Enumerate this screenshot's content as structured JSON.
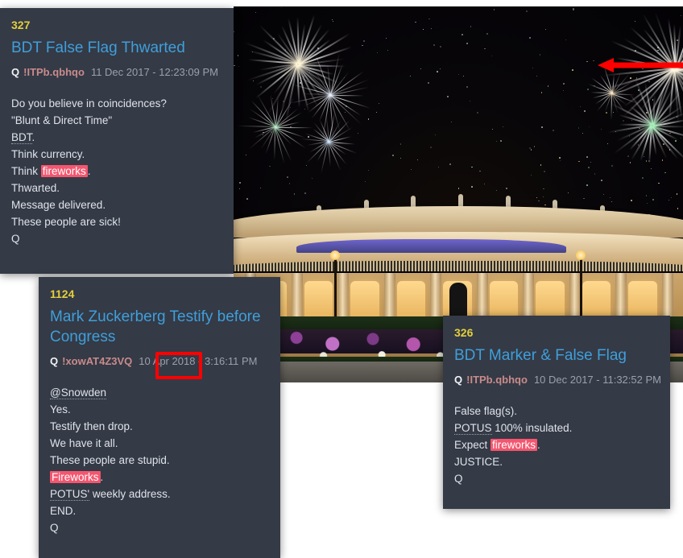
{
  "background_photo": {
    "name": "fireworks-over-resort-building",
    "description": "Night photograph of an illuminated curved neoclassical resort building with rooftop statues, colonnade, fountain and flower beds, with fireworks bursting in the night sky",
    "annotation": {
      "type": "double-headed-arrow",
      "color": "#ff0000"
    }
  },
  "posts": [
    {
      "number": "327",
      "title": "BDT False Flag Thwarted",
      "author": "Q",
      "tripcode": "!ITPb.qbhqo",
      "date": "11 Dec 2017 - 12:23:09 PM",
      "lines": [
        [
          {
            "t": "Do you believe in coincidences?"
          }
        ],
        [
          {
            "t": "\"Blunt & Direct Time\""
          }
        ],
        [
          {
            "t": "BDT",
            "style": "dotted"
          },
          {
            "t": "."
          }
        ],
        [
          {
            "t": "Think currency."
          }
        ],
        [
          {
            "t": "Think "
          },
          {
            "t": "fireworks",
            "style": "highlight"
          },
          {
            "t": "."
          }
        ],
        [
          {
            "t": "Thwarted."
          }
        ],
        [
          {
            "t": "Message delivered."
          }
        ],
        [
          {
            "t": "These people are sick!"
          }
        ],
        [
          {
            "t": "Q"
          }
        ]
      ]
    },
    {
      "number": "1124",
      "title": "Mark Zuckerberg Testify before Congress",
      "author": "Q",
      "tripcode": "!xowAT4Z3VQ",
      "date_boxed": "10 Apr",
      "date_rest": "2018 - 3:16:11 PM",
      "lines": [
        [
          {
            "t": "@Snowden",
            "style": "dotted"
          }
        ],
        [
          {
            "t": "Yes."
          }
        ],
        [
          {
            "t": "Testify then drop."
          }
        ],
        [
          {
            "t": "We have it all."
          }
        ],
        [
          {
            "t": "These people are stupid."
          }
        ],
        [
          {
            "t": "Fireworks",
            "style": "highlight"
          },
          {
            "t": "."
          }
        ],
        [
          {
            "t": "POTUS'",
            "style": "dotted"
          },
          {
            "t": " weekly address."
          }
        ],
        [
          {
            "t": "END."
          }
        ],
        [
          {
            "t": "Q"
          }
        ]
      ]
    },
    {
      "number": "326",
      "title": "BDT Marker & False Flag",
      "author": "Q",
      "tripcode": "!ITPb.qbhqo",
      "date": "10 Dec 2017 - 11:32:52 PM",
      "lines": [
        [
          {
            "t": "False flag(s)."
          }
        ],
        [
          {
            "t": "POTUS",
            "style": "dotted"
          },
          {
            "t": " 100% insulated."
          }
        ],
        [
          {
            "t": "Expect "
          },
          {
            "t": "fireworks",
            "style": "highlight"
          },
          {
            "t": "."
          }
        ],
        [
          {
            "t": "JUSTICE."
          }
        ],
        [
          {
            "t": "Q"
          }
        ]
      ]
    }
  ],
  "colors": {
    "panel_background": "#343a46",
    "post_number": "#e3cf3c",
    "post_title": "#3f9fdb",
    "tripcode": "#c98b8b",
    "date": "#9aa1ad",
    "highlight": "#f4566f",
    "annotation_red": "#ff0000"
  }
}
